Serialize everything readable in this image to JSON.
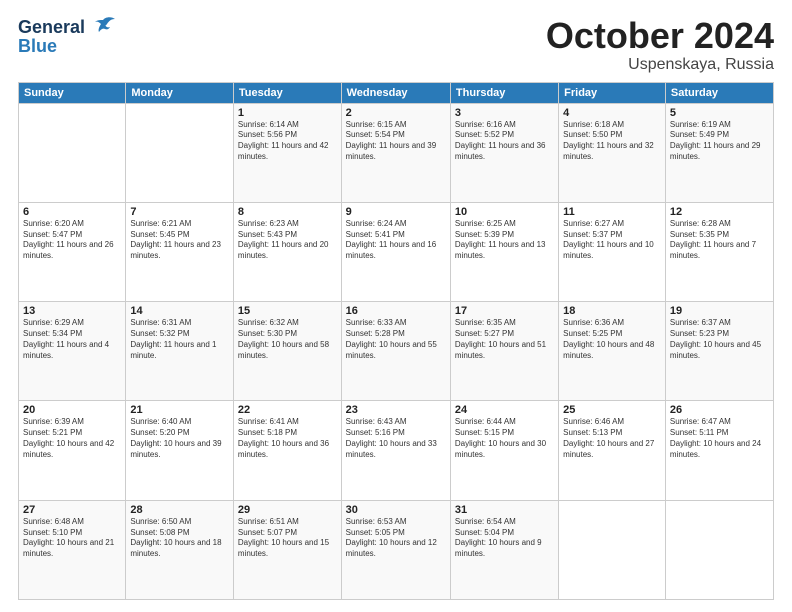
{
  "header": {
    "logo_general": "General",
    "logo_blue": "Blue",
    "month_title": "October 2024",
    "location": "Uspenskaya, Russia"
  },
  "days_of_week": [
    "Sunday",
    "Monday",
    "Tuesday",
    "Wednesday",
    "Thursday",
    "Friday",
    "Saturday"
  ],
  "weeks": [
    [
      {
        "day": "",
        "sunrise": "",
        "sunset": "",
        "daylight": ""
      },
      {
        "day": "",
        "sunrise": "",
        "sunset": "",
        "daylight": ""
      },
      {
        "day": "1",
        "sunrise": "Sunrise: 6:14 AM",
        "sunset": "Sunset: 5:56 PM",
        "daylight": "Daylight: 11 hours and 42 minutes."
      },
      {
        "day": "2",
        "sunrise": "Sunrise: 6:15 AM",
        "sunset": "Sunset: 5:54 PM",
        "daylight": "Daylight: 11 hours and 39 minutes."
      },
      {
        "day": "3",
        "sunrise": "Sunrise: 6:16 AM",
        "sunset": "Sunset: 5:52 PM",
        "daylight": "Daylight: 11 hours and 36 minutes."
      },
      {
        "day": "4",
        "sunrise": "Sunrise: 6:18 AM",
        "sunset": "Sunset: 5:50 PM",
        "daylight": "Daylight: 11 hours and 32 minutes."
      },
      {
        "day": "5",
        "sunrise": "Sunrise: 6:19 AM",
        "sunset": "Sunset: 5:49 PM",
        "daylight": "Daylight: 11 hours and 29 minutes."
      }
    ],
    [
      {
        "day": "6",
        "sunrise": "Sunrise: 6:20 AM",
        "sunset": "Sunset: 5:47 PM",
        "daylight": "Daylight: 11 hours and 26 minutes."
      },
      {
        "day": "7",
        "sunrise": "Sunrise: 6:21 AM",
        "sunset": "Sunset: 5:45 PM",
        "daylight": "Daylight: 11 hours and 23 minutes."
      },
      {
        "day": "8",
        "sunrise": "Sunrise: 6:23 AM",
        "sunset": "Sunset: 5:43 PM",
        "daylight": "Daylight: 11 hours and 20 minutes."
      },
      {
        "day": "9",
        "sunrise": "Sunrise: 6:24 AM",
        "sunset": "Sunset: 5:41 PM",
        "daylight": "Daylight: 11 hours and 16 minutes."
      },
      {
        "day": "10",
        "sunrise": "Sunrise: 6:25 AM",
        "sunset": "Sunset: 5:39 PM",
        "daylight": "Daylight: 11 hours and 13 minutes."
      },
      {
        "day": "11",
        "sunrise": "Sunrise: 6:27 AM",
        "sunset": "Sunset: 5:37 PM",
        "daylight": "Daylight: 11 hours and 10 minutes."
      },
      {
        "day": "12",
        "sunrise": "Sunrise: 6:28 AM",
        "sunset": "Sunset: 5:35 PM",
        "daylight": "Daylight: 11 hours and 7 minutes."
      }
    ],
    [
      {
        "day": "13",
        "sunrise": "Sunrise: 6:29 AM",
        "sunset": "Sunset: 5:34 PM",
        "daylight": "Daylight: 11 hours and 4 minutes."
      },
      {
        "day": "14",
        "sunrise": "Sunrise: 6:31 AM",
        "sunset": "Sunset: 5:32 PM",
        "daylight": "Daylight: 11 hours and 1 minute."
      },
      {
        "day": "15",
        "sunrise": "Sunrise: 6:32 AM",
        "sunset": "Sunset: 5:30 PM",
        "daylight": "Daylight: 10 hours and 58 minutes."
      },
      {
        "day": "16",
        "sunrise": "Sunrise: 6:33 AM",
        "sunset": "Sunset: 5:28 PM",
        "daylight": "Daylight: 10 hours and 55 minutes."
      },
      {
        "day": "17",
        "sunrise": "Sunrise: 6:35 AM",
        "sunset": "Sunset: 5:27 PM",
        "daylight": "Daylight: 10 hours and 51 minutes."
      },
      {
        "day": "18",
        "sunrise": "Sunrise: 6:36 AM",
        "sunset": "Sunset: 5:25 PM",
        "daylight": "Daylight: 10 hours and 48 minutes."
      },
      {
        "day": "19",
        "sunrise": "Sunrise: 6:37 AM",
        "sunset": "Sunset: 5:23 PM",
        "daylight": "Daylight: 10 hours and 45 minutes."
      }
    ],
    [
      {
        "day": "20",
        "sunrise": "Sunrise: 6:39 AM",
        "sunset": "Sunset: 5:21 PM",
        "daylight": "Daylight: 10 hours and 42 minutes."
      },
      {
        "day": "21",
        "sunrise": "Sunrise: 6:40 AM",
        "sunset": "Sunset: 5:20 PM",
        "daylight": "Daylight: 10 hours and 39 minutes."
      },
      {
        "day": "22",
        "sunrise": "Sunrise: 6:41 AM",
        "sunset": "Sunset: 5:18 PM",
        "daylight": "Daylight: 10 hours and 36 minutes."
      },
      {
        "day": "23",
        "sunrise": "Sunrise: 6:43 AM",
        "sunset": "Sunset: 5:16 PM",
        "daylight": "Daylight: 10 hours and 33 minutes."
      },
      {
        "day": "24",
        "sunrise": "Sunrise: 6:44 AM",
        "sunset": "Sunset: 5:15 PM",
        "daylight": "Daylight: 10 hours and 30 minutes."
      },
      {
        "day": "25",
        "sunrise": "Sunrise: 6:46 AM",
        "sunset": "Sunset: 5:13 PM",
        "daylight": "Daylight: 10 hours and 27 minutes."
      },
      {
        "day": "26",
        "sunrise": "Sunrise: 6:47 AM",
        "sunset": "Sunset: 5:11 PM",
        "daylight": "Daylight: 10 hours and 24 minutes."
      }
    ],
    [
      {
        "day": "27",
        "sunrise": "Sunrise: 6:48 AM",
        "sunset": "Sunset: 5:10 PM",
        "daylight": "Daylight: 10 hours and 21 minutes."
      },
      {
        "day": "28",
        "sunrise": "Sunrise: 6:50 AM",
        "sunset": "Sunset: 5:08 PM",
        "daylight": "Daylight: 10 hours and 18 minutes."
      },
      {
        "day": "29",
        "sunrise": "Sunrise: 6:51 AM",
        "sunset": "Sunset: 5:07 PM",
        "daylight": "Daylight: 10 hours and 15 minutes."
      },
      {
        "day": "30",
        "sunrise": "Sunrise: 6:53 AM",
        "sunset": "Sunset: 5:05 PM",
        "daylight": "Daylight: 10 hours and 12 minutes."
      },
      {
        "day": "31",
        "sunrise": "Sunrise: 6:54 AM",
        "sunset": "Sunset: 5:04 PM",
        "daylight": "Daylight: 10 hours and 9 minutes."
      },
      {
        "day": "",
        "sunrise": "",
        "sunset": "",
        "daylight": ""
      },
      {
        "day": "",
        "sunrise": "",
        "sunset": "",
        "daylight": ""
      }
    ]
  ]
}
